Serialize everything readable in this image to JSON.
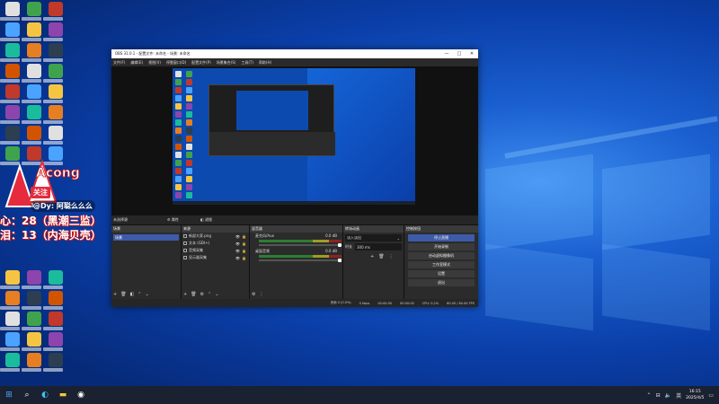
{
  "desktop": {
    "overlay_lines": [
      "心：28（黑潮三监）",
      "泪：13（内海贝壳）"
    ],
    "badge": "关注",
    "douyin": "@Dy: 阿聪么么么",
    "logo_text": "Acong"
  },
  "obs": {
    "title": "OBS 31.0.1 - 配置文件: 未命名 - 场景: 未命名",
    "menu": [
      "文件(F)",
      "编辑(E)",
      "视图(V)",
      "停靠窗口(D)",
      "配置文件(P)",
      "场景集合(S)",
      "工具(T)",
      "帮助(H)"
    ],
    "preview_label": "OBS",
    "no_source": "未选择源",
    "src_props": "属性",
    "src_filters": "滤镜",
    "docks": {
      "scenes": {
        "title": "场景",
        "items": [
          "场景"
        ]
      },
      "sources": {
        "title": "来源",
        "items": [
          "新部大家.png",
          "文本 (GDI+)",
          "音频采集",
          "显示器采集"
        ]
      },
      "mixer": {
        "title": "混音器",
        "channels": [
          {
            "name": "麦克风/Aux",
            "db": "0.0 dB"
          },
          {
            "name": "桌面音频",
            "db": "0.0 dB"
          }
        ]
      },
      "transitions": {
        "title": "转场动画",
        "type": "淡入淡出",
        "duration_label": "时长",
        "duration": "300 ms"
      },
      "controls": {
        "title": "控制按钮",
        "buttons": [
          "停止直播",
          "开始录制",
          "启动虚拟摄像机",
          "工作室模式",
          "设置",
          "退出"
        ]
      }
    },
    "status": {
      "frames": "丢帧 0 (0.0%)",
      "bitrate": "0 kbps",
      "stream_time": "00:00:00",
      "rec_time": "00:00:00",
      "cpu": "CPU: 0.2%",
      "fps": "60.00 / 60.00 FPS"
    }
  },
  "taskbar": {
    "time": "16:15",
    "date": "2025/4/5",
    "lang": "英"
  }
}
